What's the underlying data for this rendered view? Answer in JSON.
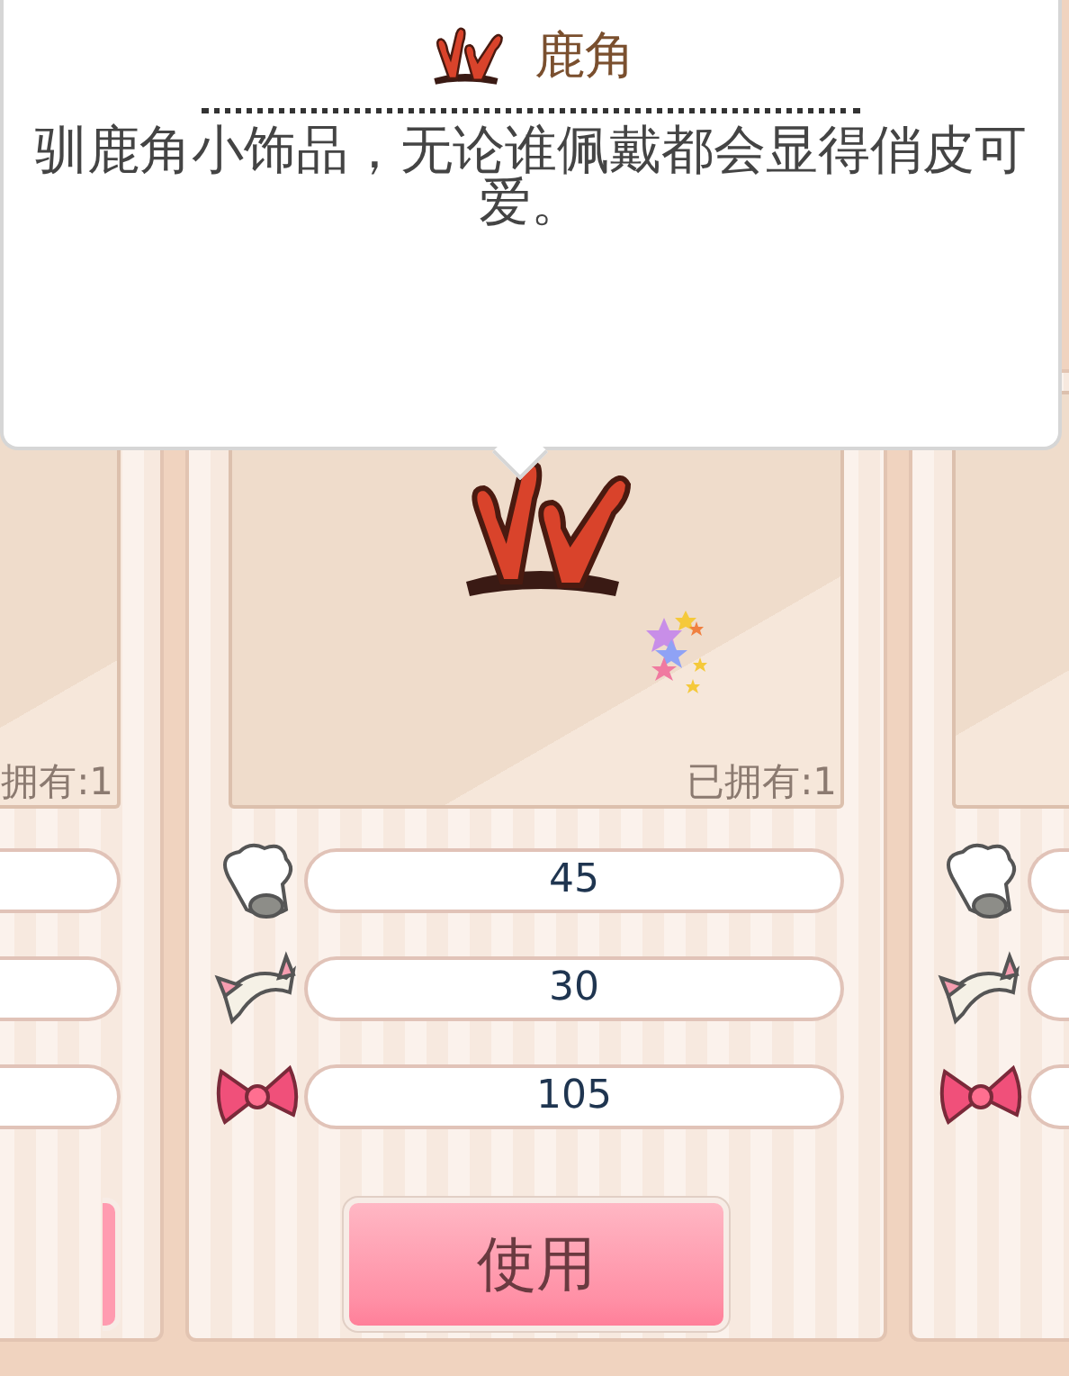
{
  "tooltip": {
    "title": "鹿角",
    "description": "驯鹿角小饰品，无论谁佩戴都会显得俏皮可爱。"
  },
  "cards": [
    {
      "kind": "left",
      "owned": "拥有:1",
      "costs": [
        {
          "kind": "field"
        },
        {
          "kind": "field"
        },
        {
          "kind": "field"
        }
      ],
      "button": {
        "kind": "edge"
      }
    },
    {
      "kind": "center",
      "owned": "已拥有:1",
      "costs": [
        {
          "kind": "hat",
          "value": "45"
        },
        {
          "kind": "headband",
          "value": "30"
        },
        {
          "kind": "bow",
          "value": "105"
        }
      ],
      "button": {
        "kind": "full",
        "label": "使用"
      }
    },
    {
      "kind": "right",
      "costs": [
        {
          "kind": "hat"
        },
        {
          "kind": "headband"
        },
        {
          "kind": "bow"
        }
      ]
    }
  ]
}
